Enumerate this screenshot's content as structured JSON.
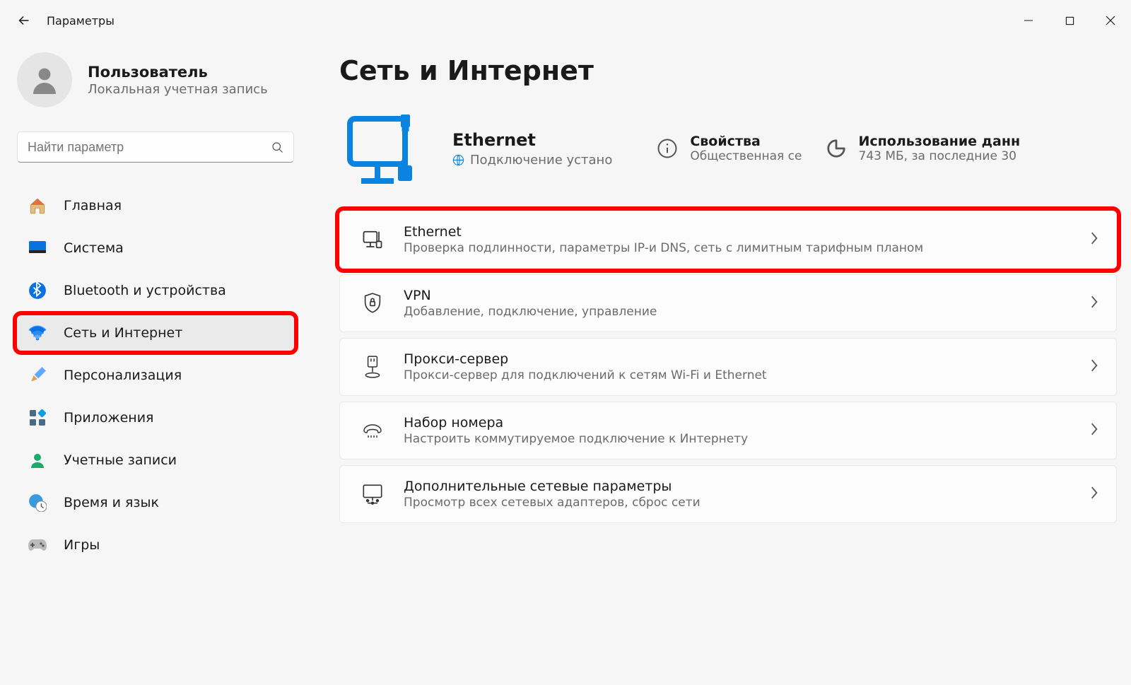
{
  "titlebar": {
    "app_name": "Параметры"
  },
  "profile": {
    "name": "Пользователь",
    "subtitle": "Локальная учетная запись"
  },
  "search": {
    "placeholder": "Найти параметр"
  },
  "sidebar": {
    "items": [
      {
        "label": "Главная"
      },
      {
        "label": "Система"
      },
      {
        "label": "Bluetooth и устройства"
      },
      {
        "label": "Сеть и Интернет"
      },
      {
        "label": "Персонализация"
      },
      {
        "label": "Приложения"
      },
      {
        "label": "Учетные записи"
      },
      {
        "label": "Время и язык"
      },
      {
        "label": "Игры"
      }
    ]
  },
  "page": {
    "title": "Сеть и Интернет",
    "status": {
      "name": "Ethernet",
      "state": "Подключение устано",
      "properties_label": "Свойства",
      "properties_sub": "Общественная се",
      "usage_label": "Использование данн",
      "usage_sub": "743 МБ, за последние 30"
    },
    "cards": [
      {
        "title": "Ethernet",
        "subtitle": "Проверка подлинности, параметры IP-и DNS, сеть с лимитным тарифным планом"
      },
      {
        "title": "VPN",
        "subtitle": "Добавление, подключение, управление"
      },
      {
        "title": "Прокси-сервер",
        "subtitle": "Прокси-сервер для подключений к сетям Wi-Fi и Ethernet"
      },
      {
        "title": "Набор номера",
        "subtitle": "Настроить коммутируемое подключение к Интернету"
      },
      {
        "title": "Дополнительные сетевые параметры",
        "subtitle": "Просмотр всех сетевых адаптеров, сброс сети"
      }
    ]
  }
}
